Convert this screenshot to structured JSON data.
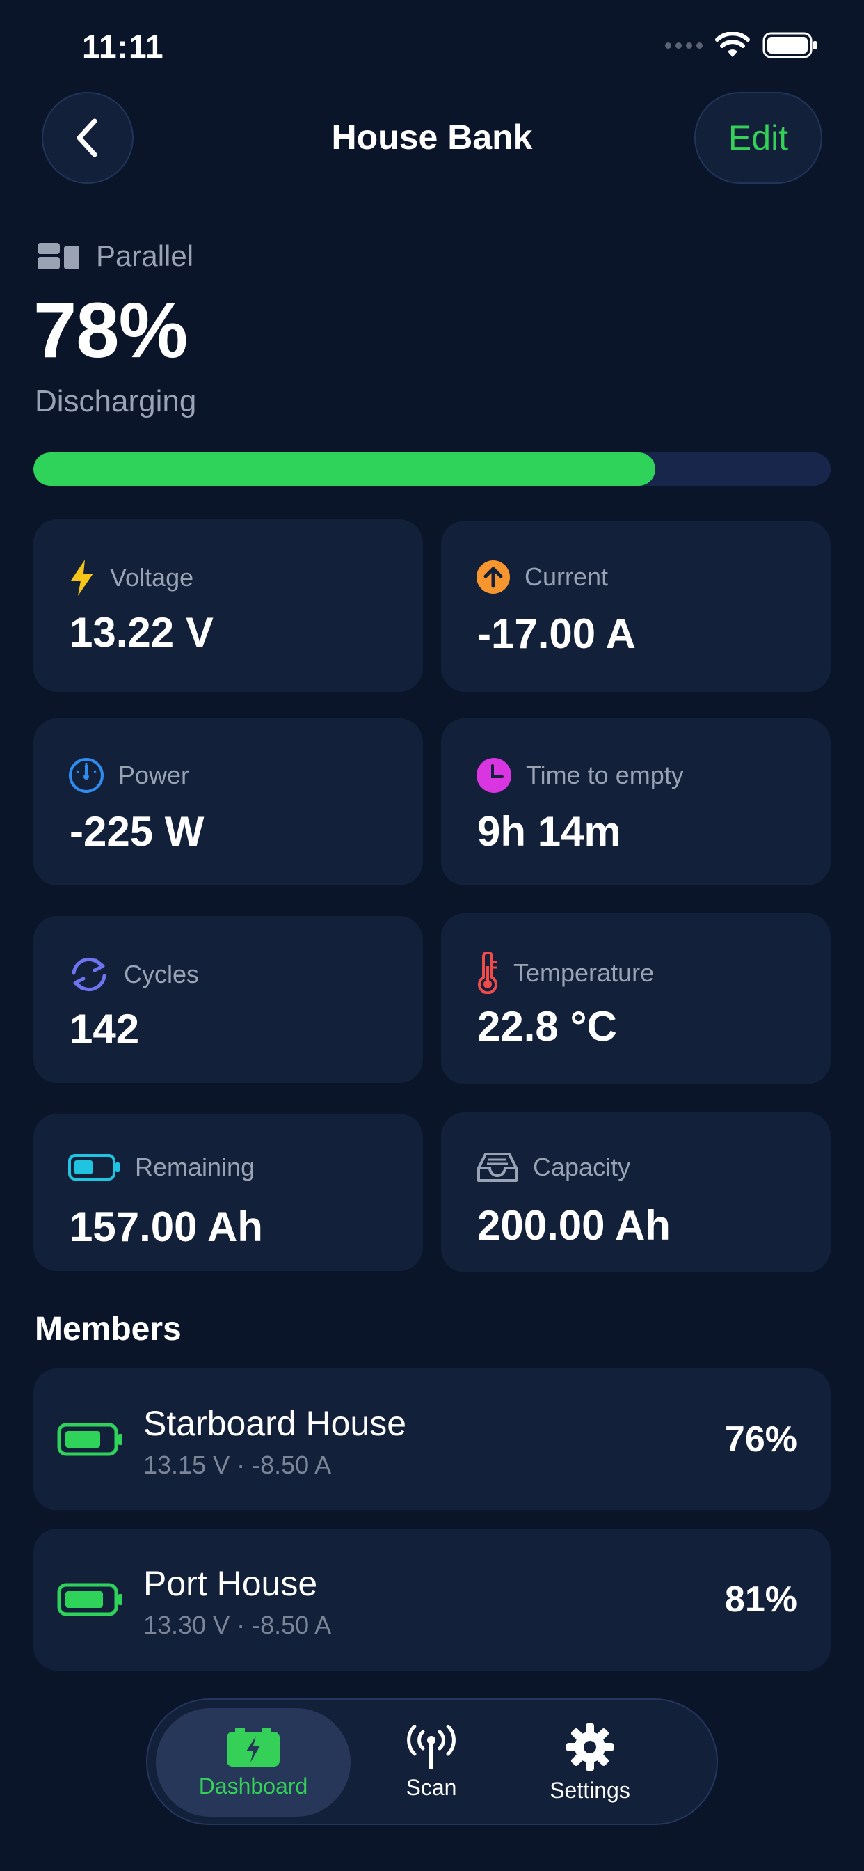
{
  "status_bar": {
    "time": "11:11"
  },
  "header": {
    "title": "House Bank",
    "edit_label": "Edit"
  },
  "summary": {
    "topology": "Parallel",
    "soc": "78%",
    "soc_fraction": 0.78,
    "state": "Discharging"
  },
  "metrics": {
    "voltage": {
      "label": "Voltage",
      "value": "13.22 V"
    },
    "current": {
      "label": "Current",
      "value": "-17.00 A"
    },
    "power": {
      "label": "Power",
      "value": "-225 W"
    },
    "time_to_empty": {
      "label": "Time to empty",
      "value": "9h 14m"
    },
    "cycles": {
      "label": "Cycles",
      "value": "142"
    },
    "temperature": {
      "label": "Temperature",
      "value": "22.8 °C"
    },
    "remaining": {
      "label": "Remaining",
      "value": "157.00 Ah"
    },
    "capacity": {
      "label": "Capacity",
      "value": "200.00 Ah"
    }
  },
  "members": {
    "title": "Members",
    "items": [
      {
        "name": "Starboard House",
        "detail": "13.15 V · -8.50 A",
        "percent": "76%"
      },
      {
        "name": "Port House",
        "detail": "13.30 V · -8.50 A",
        "percent": "81%"
      }
    ]
  },
  "tabbar": {
    "dashboard": "Dashboard",
    "scan": "Scan",
    "settings": "Settings"
  },
  "colors": {
    "background": "#0b1529",
    "card": "#13203a",
    "accent_green": "#34d058",
    "voltage": "#f5c518",
    "current": "#f7952e",
    "power": "#2f8cf0",
    "time": "#d935e0",
    "cycles": "#6e74f0",
    "temperature": "#f04a4a",
    "remaining": "#20c4e0"
  },
  "icons": [
    "chevron-left-icon",
    "parallel-icon",
    "bolt-icon",
    "arrow-up-circle-icon",
    "gauge-icon",
    "clock-icon",
    "refresh-icon",
    "thermometer-icon",
    "battery-icon",
    "tray-icon",
    "antenna-icon",
    "gear-icon",
    "wifi-icon",
    "signal-icon"
  ]
}
